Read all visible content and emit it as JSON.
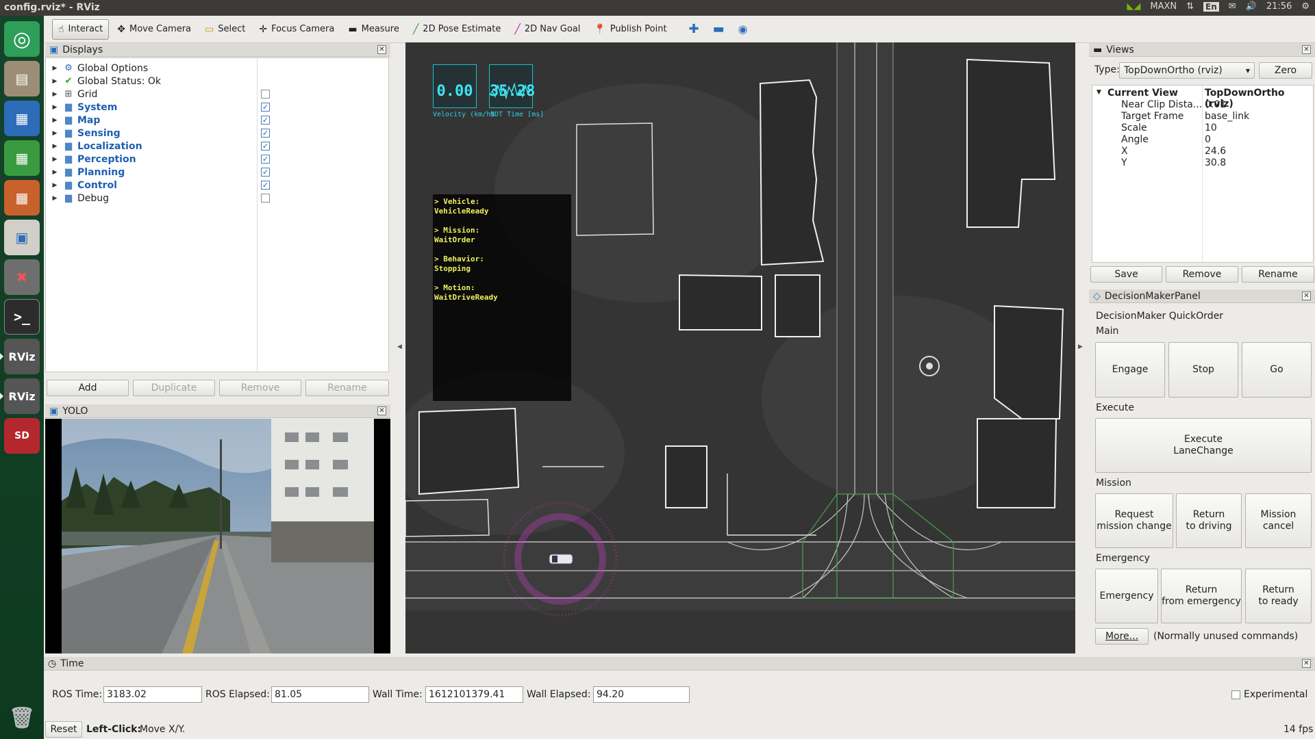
{
  "window": {
    "title": "config.rviz* - RViz",
    "tray": {
      "power_mode": "MAXN",
      "keyboard": "En",
      "clock": "21:56"
    }
  },
  "toolbar": {
    "tools": [
      {
        "label": "Interact",
        "icon": "hand-pointer-icon"
      },
      {
        "label": "Move Camera",
        "icon": "move-camera-icon"
      },
      {
        "label": "Select",
        "icon": "select-rect-icon"
      },
      {
        "label": "Focus Camera",
        "icon": "focus-camera-icon"
      },
      {
        "label": "Measure",
        "icon": "ruler-icon"
      },
      {
        "label": "2D Pose Estimate",
        "icon": "green-arrow-icon"
      },
      {
        "label": "2D Nav Goal",
        "icon": "magenta-arrow-icon"
      },
      {
        "label": "Publish Point",
        "icon": "map-pin-icon"
      }
    ]
  },
  "displays": {
    "title": "Displays",
    "items": [
      {
        "label": "Global Options",
        "icon": "gear",
        "checked": null,
        "blue": false
      },
      {
        "label": "Global Status: Ok",
        "icon": "check",
        "checked": null,
        "blue": false
      },
      {
        "label": "Grid",
        "icon": "grid",
        "checked": false,
        "blue": false
      },
      {
        "label": "System",
        "icon": "folder",
        "checked": true,
        "blue": true
      },
      {
        "label": "Map",
        "icon": "folder",
        "checked": true,
        "blue": true
      },
      {
        "label": "Sensing",
        "icon": "folder",
        "checked": true,
        "blue": true
      },
      {
        "label": "Localization",
        "icon": "folder",
        "checked": true,
        "blue": true
      },
      {
        "label": "Perception",
        "icon": "folder",
        "checked": true,
        "blue": true
      },
      {
        "label": "Planning",
        "icon": "folder",
        "checked": true,
        "blue": true
      },
      {
        "label": "Control",
        "icon": "folder",
        "checked": true,
        "blue": true
      },
      {
        "label": "Debug",
        "icon": "folder",
        "checked": false,
        "blue": false
      }
    ],
    "buttons": {
      "add": "Add",
      "duplicate": "Duplicate",
      "remove": "Remove",
      "rename": "Rename"
    }
  },
  "yolo": {
    "title": "YOLO"
  },
  "view3d": {
    "velocity_value": "0.00",
    "velocity_label": "Velocity (km/h)",
    "ndt_value": "35.28",
    "ndt_label": "NDT Time [ms]",
    "state_lines": [
      "> Vehicle:",
      "VehicleReady",
      "",
      "> Mission:",
      "WaitOrder",
      "",
      "> Behavior:",
      "Stopping",
      "",
      "> Motion:",
      "WaitDriveReady"
    ]
  },
  "views": {
    "title": "Views",
    "type_label": "Type:",
    "type_value": "TopDownOrtho (rviz)",
    "zero": "Zero",
    "props": [
      {
        "k": "Current View",
        "v": "TopDownOrtho (rviz)"
      },
      {
        "k": "Near Clip Dista...",
        "v": "0.01"
      },
      {
        "k": "Target Frame",
        "v": "base_link"
      },
      {
        "k": "Scale",
        "v": "10"
      },
      {
        "k": "Angle",
        "v": "0"
      },
      {
        "k": "X",
        "v": "24.6"
      },
      {
        "k": "Y",
        "v": "30.8"
      }
    ],
    "buttons": {
      "save": "Save",
      "remove": "Remove",
      "rename": "Rename"
    }
  },
  "decision": {
    "title": "DecisionMakerPanel",
    "subtitle": "DecisionMaker QuickOrder",
    "main_label": "Main",
    "engage": "Engage",
    "stop": "Stop",
    "go": "Go",
    "execute_label": "Execute",
    "execute_lanechange": "Execute\nLaneChange",
    "mission_label": "Mission",
    "request_mission_change": "Request\nmission change",
    "return_to_driving": "Return\nto driving",
    "mission_cancel": "Mission\ncancel",
    "emergency_label": "Emergency",
    "emergency": "Emergency",
    "return_from_emergency": "Return\nfrom emergency",
    "return_to_ready": "Return\nto ready",
    "more": "More...",
    "more_note": "(Normally unused commands)"
  },
  "time": {
    "title": "Time",
    "ros_time_label": "ROS Time:",
    "ros_time": "3183.02",
    "ros_elapsed_label": "ROS Elapsed:",
    "ros_elapsed": "81.05",
    "wall_time_label": "Wall Time:",
    "wall_time": "1612101379.41",
    "wall_elapsed_label": "Wall Elapsed:",
    "wall_elapsed": "94.20",
    "experimental": "Experimental",
    "reset": "Reset",
    "hint_bold": "Left-Click:",
    "hint": "Move X/Y.",
    "fps": "14 fps"
  }
}
